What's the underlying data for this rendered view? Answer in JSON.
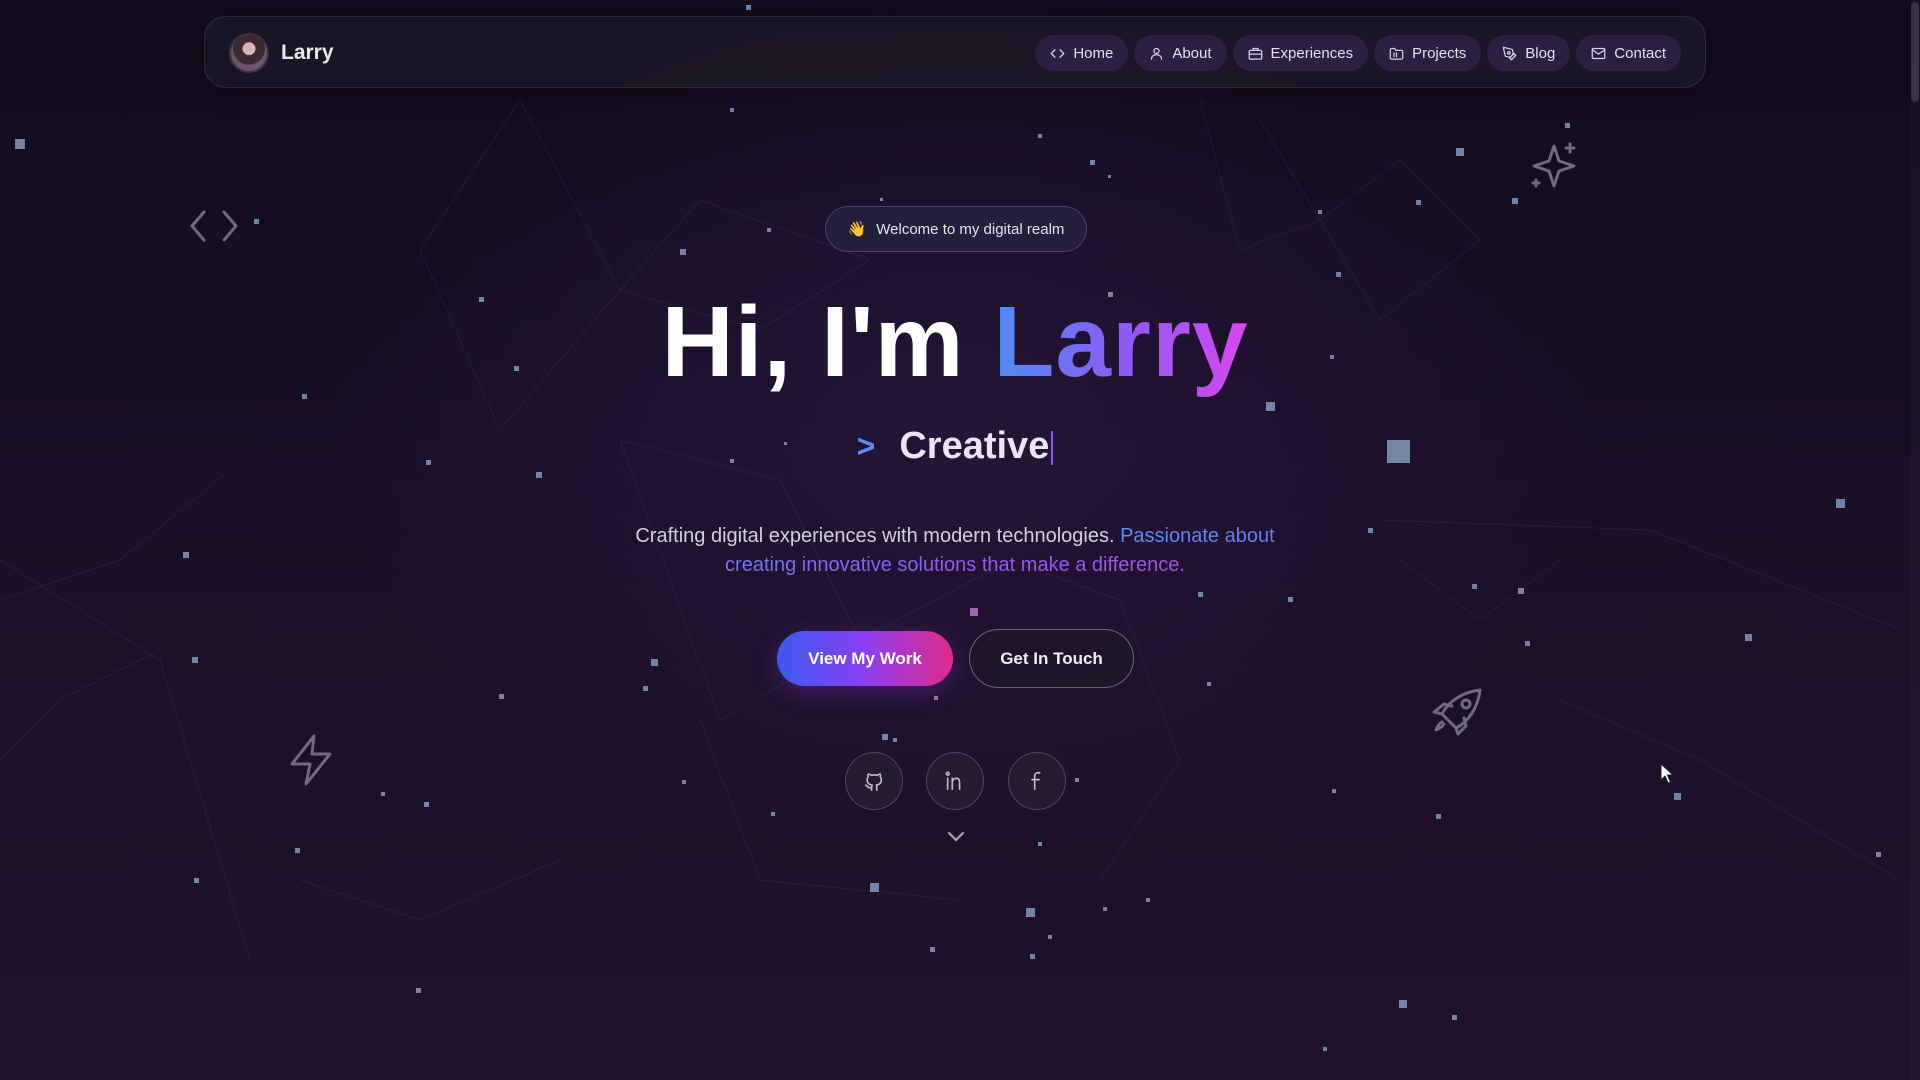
{
  "navbar": {
    "brand_name": "Larry",
    "items": [
      {
        "label": "Home",
        "icon": "code-icon"
      },
      {
        "label": "About",
        "icon": "user-icon"
      },
      {
        "label": "Experiences",
        "icon": "briefcase-icon"
      },
      {
        "label": "Projects",
        "icon": "folder-icon"
      },
      {
        "label": "Blog",
        "icon": "pen-tool-icon"
      },
      {
        "label": "Contact",
        "icon": "mail-icon"
      }
    ]
  },
  "hero": {
    "badge_emoji": "👋",
    "badge_text": "Welcome to my digital realm",
    "title_prefix": "Hi, I'm ",
    "title_name": "Larry",
    "prompt_symbol": ">",
    "typed_word": "Creative",
    "description_plain": "Crafting digital experiences with modern technologies. ",
    "description_accent": "Passionate about creating innovative solutions that make a difference.",
    "primary_button": "View My Work",
    "secondary_button": "Get In Touch"
  },
  "social": [
    {
      "icon": "github-icon"
    },
    {
      "icon": "linkedin-icon"
    },
    {
      "icon": "facebook-icon"
    }
  ],
  "decorative_icons": [
    "code-brackets-icon",
    "sparkles-icon",
    "zap-icon",
    "rocket-icon",
    "chevron-down-icon"
  ],
  "colors": {
    "background": "#150c1e",
    "accent_blue": "#4f8cf5",
    "accent_purple": "#8b5cf6",
    "accent_pink": "#d946ef"
  }
}
